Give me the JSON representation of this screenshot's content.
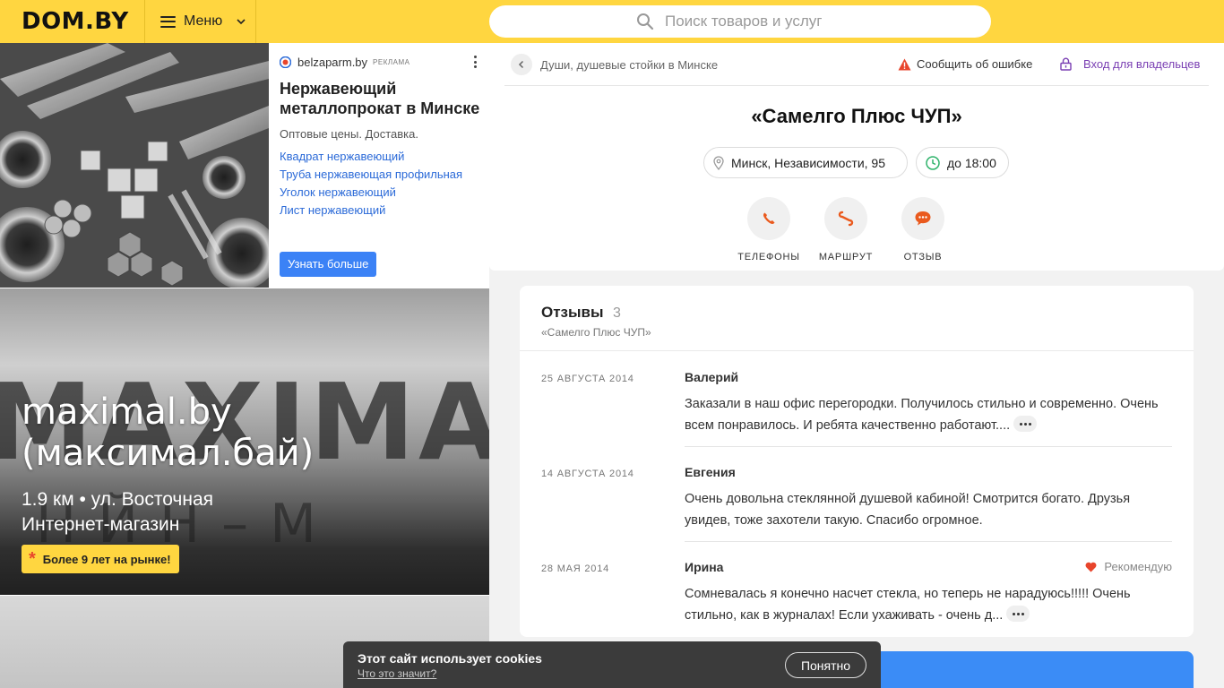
{
  "header": {
    "logo": "DOM.BY",
    "menu_label": "Меню",
    "search_placeholder": "Поиск товаров и услуг",
    "accent_color": "#ffd640"
  },
  "ad_top": {
    "source": "belzaparm.by",
    "tag": "РЕКЛАМА",
    "title": "Нержавеющий металлопрокат в Минске",
    "description": "Оптовые цены. Доставка.",
    "links": [
      "Квадрат нержавеющий",
      "Труба нержавеющая профильная",
      "Уголок нержавеющий",
      "Лист нержавеющий"
    ],
    "button": "Узнать больше"
  },
  "ad_middle": {
    "title_line1": "maximal.by",
    "title_line2": "(максимал.бай)",
    "meta_line1": "1.9 км • ул. Восточная",
    "meta_line2": "Интернет-магазин",
    "badge": "Более 9 лет на рынке!"
  },
  "company": {
    "breadcrumb": "Души, душевые стойки в Минске",
    "report": "Сообщить об ошибке",
    "owners": "Вход для владельцев",
    "name": "«Самелго Плюс ЧУП»",
    "address": "Минск, Независимости, 95",
    "hours": "до 18:00",
    "actions": [
      {
        "label": "ТЕЛЕФОНЫ",
        "icon": "phone-icon"
      },
      {
        "label": "МАРШРУТ",
        "icon": "route-icon"
      },
      {
        "label": "ОТЗЫВ",
        "icon": "chat-icon"
      }
    ],
    "action_color": "#ea5a1e"
  },
  "reviews": {
    "title": "Отзывы",
    "count": "3",
    "subtitle": "«Самелго Плюс ЧУП»",
    "items": [
      {
        "date": "25 АВГУСТА 2014",
        "author": "Валерий",
        "text": "Заказали в наш офис перегородки. Получилось стильно и современно. Очень всем понравилось. И ребята качественно работают....",
        "truncated": true
      },
      {
        "date": "14 АВГУСТА 2014",
        "author": "Евгения",
        "text": "Очень довольна стеклянной душевой кабиной! Смотрится богато.  Друзья увидев, тоже захотели такую. Спасибо огромное.",
        "truncated": false
      },
      {
        "date": "28 МАЯ 2014",
        "author": "Ирина",
        "recommend": "Рекомендую",
        "text": "Сомневалась я конечно насчет стекла, но теперь не нарадуюсь!!!!! Очень стильно, как в журналах! Если ухаживать - очень д...",
        "truncated": true
      }
    ]
  },
  "cookie": {
    "title": "Этот сайт использует cookies",
    "link": "Что это значит?",
    "button": "Понятно"
  }
}
